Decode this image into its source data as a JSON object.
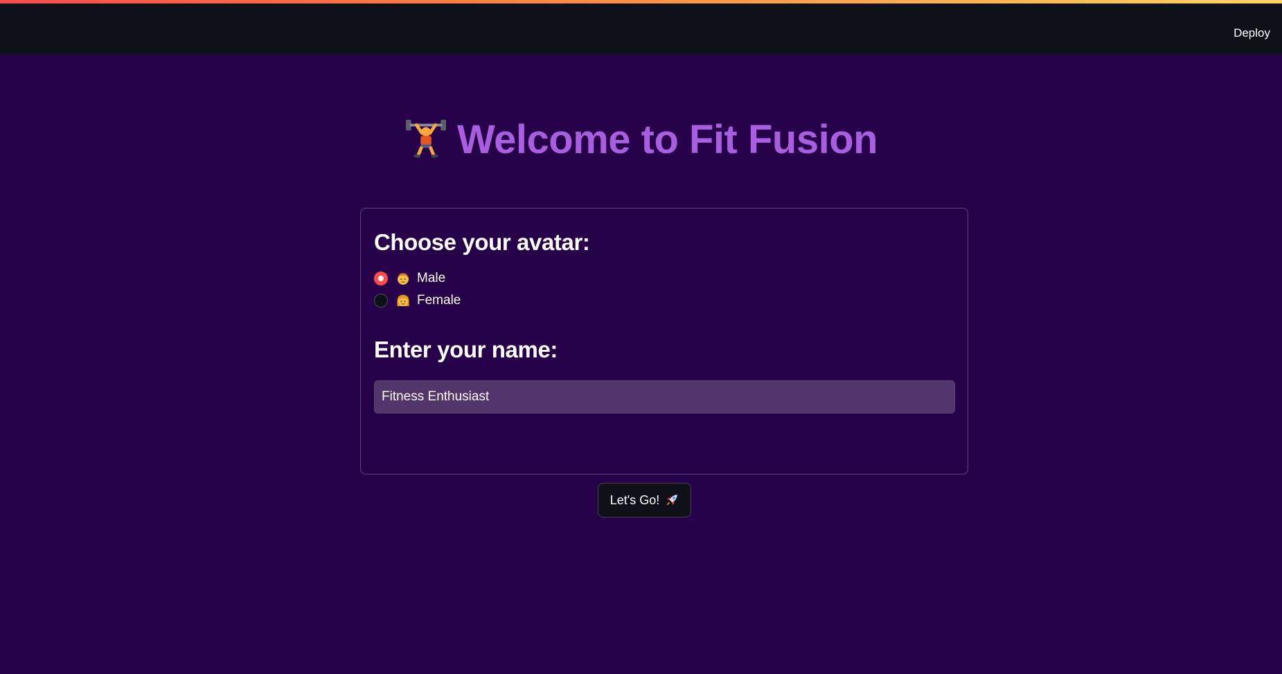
{
  "header": {
    "deploy_label": "Deploy"
  },
  "hero": {
    "title": "Welcome to Fit Fusion",
    "icon": "weight-lifter-icon"
  },
  "form": {
    "avatar_heading": "Choose your avatar:",
    "avatar_options": [
      {
        "label": "Male",
        "icon": "man-face-icon",
        "selected": true
      },
      {
        "label": "Female",
        "icon": "woman-face-icon",
        "selected": false
      }
    ],
    "name_heading": "Enter your name:",
    "name_value": "Fitness Enthusiast",
    "submit_label": "Let's Go!",
    "submit_icon": "rocket-icon"
  },
  "colors": {
    "background": "#27004a",
    "header": "#0e1117",
    "title": "#a75fe0",
    "radio_selected": "#ff4b4b",
    "input_background": "#52356b"
  }
}
